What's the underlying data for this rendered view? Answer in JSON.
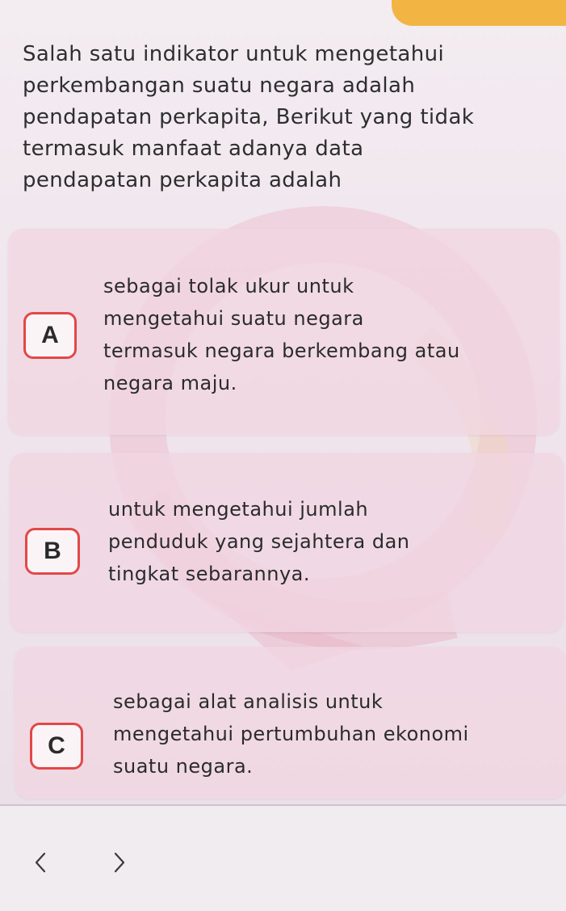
{
  "question": {
    "lines": [
      "Salah satu indikator untuk mengetahui",
      "perkembangan suatu negara adalah",
      "pendapatan perkapita, Berikut yang tidak",
      "termasuk manfaat adanya data",
      "pendapatan perkapita adalah"
    ]
  },
  "options": [
    {
      "letter": "A",
      "lines": [
        "sebagai tolak ukur untuk",
        "mengetahui suatu negara",
        "termasuk negara berkembang atau",
        "negara maju."
      ]
    },
    {
      "letter": "B",
      "lines": [
        "untuk mengetahui jumlah",
        "penduduk yang sejahtera dan",
        "tingkat sebarannya."
      ]
    },
    {
      "letter": "C",
      "lines": [
        "sebagai alat analisis untuk",
        "mengetahui pertumbuhan ekonomi",
        "suatu negara."
      ]
    }
  ],
  "navigation": {
    "prev_icon": "chevron-left-icon",
    "next_icon": "chevron-right-icon"
  },
  "colors": {
    "accent_tab": "#f2b544",
    "letter_border": "#e24848",
    "option_card": "#f1d6e1"
  }
}
